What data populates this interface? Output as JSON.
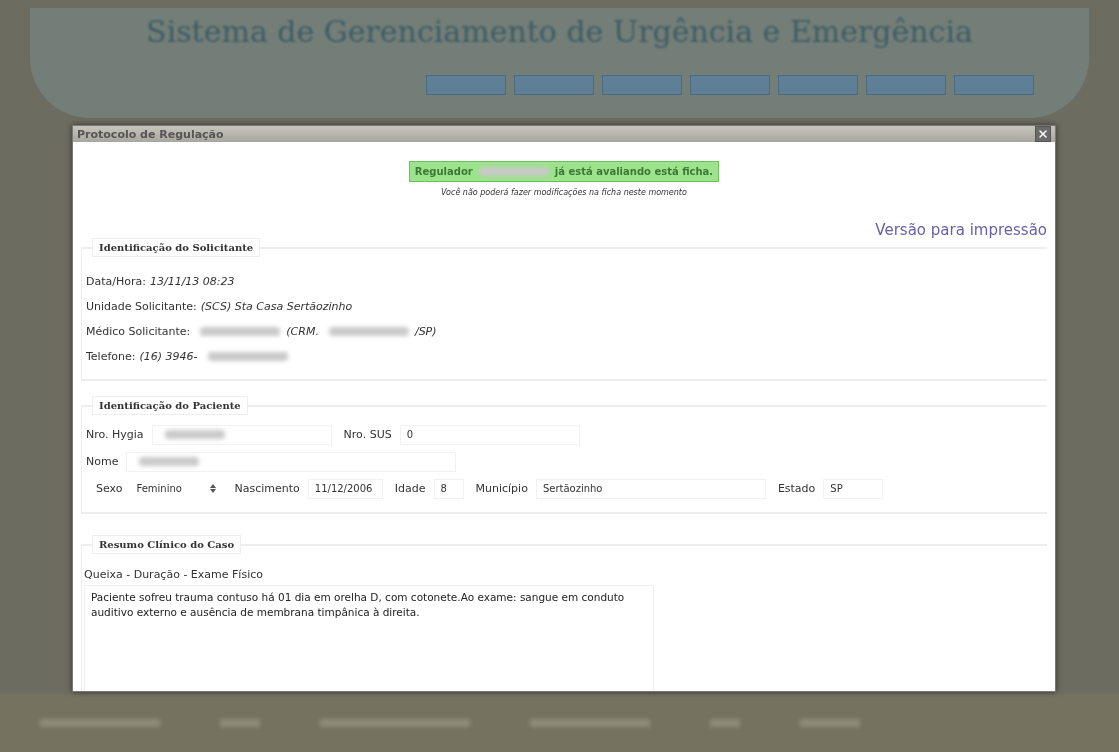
{
  "app_title": "Sistema de Gerenciamento de Urgência e Emergência",
  "dialog": {
    "title": "Protocolo de Regulação",
    "notice": {
      "lead": "Regulador",
      "tail": "já está avaliando está ficha.",
      "subtext": "Você não poderá fazer modificações na ficha neste momento"
    },
    "print_link": "Versão para impressão",
    "requester": {
      "legend": "Identificação do Solicitante",
      "lines": [
        {
          "label": "Data/Hora:",
          "parts": [
            {
              "kind": "text",
              "text": "13/11/13 08:23"
            }
          ]
        },
        {
          "label": "Unidade Solicitante:",
          "parts": [
            {
              "kind": "text",
              "text": "(SCS) Sta Casa Sertãozinho"
            }
          ]
        },
        {
          "label": "Médico Solicitante:",
          "parts": [
            {
              "kind": "redacted"
            },
            {
              "kind": "text",
              "text": "(CRM."
            },
            {
              "kind": "redacted"
            },
            {
              "kind": "text",
              "text": "/SP)"
            }
          ]
        },
        {
          "label": "Telefone:",
          "parts": [
            {
              "kind": "text",
              "text": "(16) 3946-"
            },
            {
              "kind": "redacted"
            }
          ]
        }
      ]
    },
    "patient": {
      "legend": "Identificação do Paciente",
      "rows": [
        [
          {
            "label": "Nro. Hygia",
            "kind": "input",
            "redacted": true
          },
          {
            "label": "Nro. SUS",
            "kind": "input",
            "redacted": false,
            "value": "0"
          }
        ],
        [
          {
            "label": "Nome",
            "kind": "input",
            "redacted": true
          }
        ],
        [
          {
            "label": "Sexo",
            "kind": "select",
            "redacted": false,
            "value": "Feminino"
          },
          {
            "label": "Nascimento",
            "kind": "input",
            "redacted": false,
            "value": "11/12/2006"
          },
          {
            "label": "Idade",
            "kind": "input",
            "redacted": false,
            "value": "8"
          },
          {
            "label": "Município",
            "kind": "input",
            "redacted": false,
            "value": "Sertãozinho"
          },
          {
            "label": "Estado",
            "kind": "input",
            "redacted": false,
            "value": "SP"
          }
        ]
      ]
    },
    "clinical": {
      "legend": "Resumo Clínico do Caso",
      "label": "Queixa - Duração - Exame Físico",
      "text": "Paciente sofreu trauma contuso há 01 dia em orelha D, com cotonete.Ao exame: sangue em conduto auditivo externo e ausência de membrana timpânica à direita."
    }
  }
}
